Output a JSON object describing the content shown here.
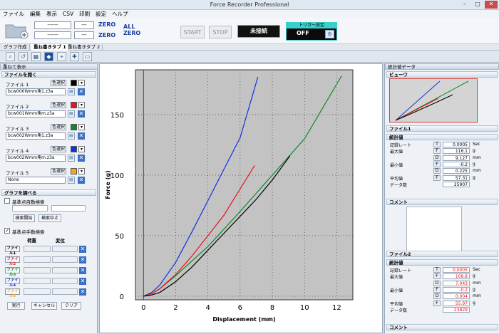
{
  "window": {
    "title": "Force Recorder Professional"
  },
  "menu": [
    "ファイル",
    "編集",
    "表示",
    "CSV",
    "印刷",
    "設定",
    "ヘルプ"
  ],
  "toolbar": {
    "field1": "------",
    "field1_unit": "---",
    "field2": "------",
    "field2_unit": "---",
    "zero1": "ZERO",
    "zero2": "ZERO",
    "all_zero_1": "ALL",
    "all_zero_2": "ZERO",
    "start": "START",
    "stop": "STOP",
    "connection": "未接続",
    "trigger_label": "トリガー設定",
    "trigger_value": "OFF"
  },
  "tabs": [
    "グラフ作成",
    "重ね書きタブ 1",
    "重ね書きタブ 2"
  ],
  "left": {
    "panel_title": "重ねて表示",
    "section_files": "ファイルを開く",
    "color_btn": "色選択",
    "files": [
      {
        "label": "ファイル 1",
        "path": "bcw000Wmm角1.z3a",
        "color": "#000000"
      },
      {
        "label": "ファイル 2",
        "path": "bcw001Wmm角m.z3a",
        "color": "#e8141c"
      },
      {
        "label": "ファイル 3",
        "path": "bcw002Wmm角1.z3a",
        "color": "#0a8a2a"
      },
      {
        "label": "ファイル 4",
        "path": "bcw002Wmm角m.z3a",
        "color": "#1230e0"
      },
      {
        "label": "ファイル 5",
        "path": "None",
        "color": "#f5a623"
      }
    ],
    "section_graph": "グラフを調べる",
    "auto_search": "基準点自動検索",
    "search_start": "検索開始",
    "search_stop": "検索中止",
    "manual_search": "基準点手動検索",
    "col_load": "荷重",
    "col_disp": "変位",
    "file_buttons": [
      {
        "label": "ファイル1",
        "color": "#000000"
      },
      {
        "label": "ファイル2",
        "color": "#e8141c"
      },
      {
        "label": "ファイル3",
        "color": "#0a8a2a"
      },
      {
        "label": "ファイル4",
        "color": "#1230e0"
      },
      {
        "label": "ファイル5",
        "color": "#f5a623"
      }
    ],
    "run": "実行",
    "cancel": "キャンセル",
    "clear": "クリア"
  },
  "chart_data": {
    "type": "line",
    "xlabel": "Displacement (mm)",
    "ylabel": "Force (g)",
    "xlim": [
      -0.5,
      13
    ],
    "ylim": [
      -3,
      187
    ],
    "xticks": [
      0,
      2,
      4,
      6,
      8,
      10,
      12
    ],
    "yticks": [
      0,
      50,
      100,
      150
    ],
    "series": [
      {
        "color": "#1230e0",
        "x": [
          0,
          0.5,
          1,
          2,
          3,
          4,
          5,
          6,
          7.1
        ],
        "y": [
          0,
          3,
          9,
          28,
          53,
          79,
          105,
          131,
          181
        ]
      },
      {
        "color": "#0a8a2a",
        "x": [
          0,
          0.5,
          1,
          2,
          4,
          6,
          8,
          10,
          12.3
        ],
        "y": [
          0,
          2,
          6,
          17,
          41,
          70,
          100,
          130,
          182
        ]
      },
      {
        "color": "#e8141c",
        "x": [
          0,
          0.5,
          1,
          2,
          3,
          4,
          5,
          6.9
        ],
        "y": [
          0,
          2,
          6,
          18,
          33,
          50,
          67,
          108
        ]
      },
      {
        "color": "#000000",
        "x": [
          0,
          0.5,
          1,
          2,
          3,
          4,
          5,
          6,
          7,
          8,
          9.1
        ],
        "y": [
          0,
          1,
          3,
          12,
          24,
          38,
          52,
          66,
          80,
          96,
          116
        ]
      }
    ]
  },
  "right": {
    "panel_title": "統計値データ",
    "preview": "ビューワ",
    "file1": "ファイル1",
    "stats": "統計値",
    "comment": "コメント",
    "file2": "ファイル2",
    "stats_rows": [
      {
        "label": "記録レート",
        "key": "T",
        "v1": "0.0005",
        "u1": "Sec",
        "v2": "0.0005",
        "u2": "Sec"
      },
      {
        "label": "最大値",
        "key": "F",
        "v1": "116.1",
        "u1": "g",
        "v2": "108.8",
        "u2": "g"
      },
      {
        "label": "",
        "key": "D",
        "v1": "9.127",
        "u1": "mm",
        "v2": "7.043",
        "u2": "mm"
      },
      {
        "label": "最小値",
        "key": "F",
        "v1": "-0.2",
        "u1": "g",
        "v2": "-0.2",
        "u2": "g"
      },
      {
        "label": "",
        "key": "D",
        "v1": "0.225",
        "u1": "mm",
        "v2": "0.004",
        "u2": "mm"
      },
      {
        "label": "平均値",
        "key": "F",
        "v1": "57.31",
        "u1": "g",
        "v2": "55.97",
        "u2": "g"
      },
      {
        "label": "データ数",
        "key": "",
        "v1": "25907",
        "u1": "",
        "v2": "23829",
        "u2": ""
      }
    ]
  }
}
